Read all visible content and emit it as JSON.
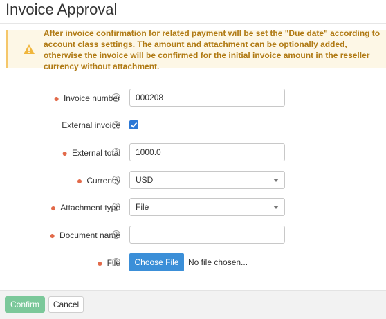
{
  "page": {
    "title": "Invoice Approval"
  },
  "warning": {
    "text": "After invoice confirmation for related payment will be set the \"Due date\" according to account class settings. The amount and attachment can be optionally added, otherwise the invoice will be confirmed for the initial invoice amount in the reseller currency without attachment.",
    "color": "#b07a14"
  },
  "form": {
    "invoice_number": {
      "label": "Invoice number",
      "value": "000208",
      "required": true
    },
    "external_invoice": {
      "label": "External invoice",
      "checked": true,
      "required": false
    },
    "external_total": {
      "label": "External total",
      "value": "1000.0",
      "required": true
    },
    "currency": {
      "label": "Currency",
      "value": "USD",
      "required": true
    },
    "attachment_type": {
      "label": "Attachment type",
      "value": "File",
      "required": true
    },
    "document_name": {
      "label": "Document name",
      "value": "",
      "required": true
    },
    "file": {
      "label": "File",
      "button_label": "Choose File",
      "status": "No file chosen...",
      "required": true
    }
  },
  "footer": {
    "confirm_label": "Confirm",
    "cancel_label": "Cancel"
  },
  "colors": {
    "required_marker": "#e26a4a",
    "primary": "#3b8fd8",
    "confirm": "#7bc89a"
  }
}
